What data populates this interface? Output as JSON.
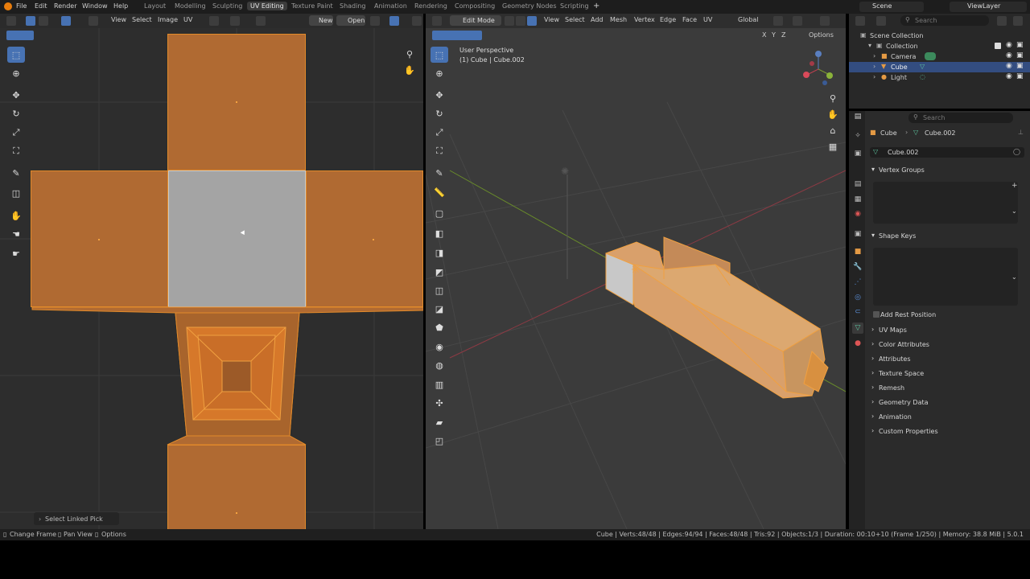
{
  "topbar": {
    "menus": [
      "File",
      "Edit",
      "Render",
      "Window",
      "Help"
    ],
    "workspaces": [
      "Layout",
      "Modelling",
      "Sculpting",
      "UV Editing",
      "Texture Paint",
      "Shading",
      "Animation",
      "Rendering",
      "Compositing",
      "Geometry Nodes",
      "Scripting"
    ],
    "active_workspace": "UV Editing",
    "scene": "Scene",
    "view_layer": "ViewLayer"
  },
  "uv_editor": {
    "menus": [
      "View",
      "Select",
      "Image",
      "UV"
    ],
    "new_label": "New",
    "open_label": "Open",
    "operator_panel": "Select Linked Pick"
  },
  "viewport": {
    "mode": "Edit Mode",
    "menus": [
      "View",
      "Select",
      "Add",
      "Mesh",
      "Vertex",
      "Edge",
      "Face",
      "UV"
    ],
    "transform_orientation": "Global",
    "axes": [
      "X",
      "Y",
      "Z"
    ],
    "options_label": "Options",
    "info_line1": "User Perspective",
    "info_line2": "(1) Cube | Cube.002"
  },
  "outliner": {
    "search_placeholder": "Search",
    "rows": [
      {
        "label": "Scene Collection",
        "icon": "collection-icon"
      },
      {
        "label": "Collection",
        "icon": "collection-icon"
      },
      {
        "label": "Camera",
        "icon": "camera-icon"
      },
      {
        "label": "Cube",
        "icon": "mesh-icon"
      },
      {
        "label": "Light",
        "icon": "light-icon"
      }
    ]
  },
  "properties": {
    "search_placeholder": "Search",
    "breadcrumb_object": "Cube",
    "breadcrumb_data": "Cube.002",
    "data_name": "Cube.002",
    "panels": [
      "Vertex Groups",
      "Shape Keys",
      "UV Maps",
      "Color Attributes",
      "Attributes",
      "Texture Space",
      "Remesh",
      "Geometry Data",
      "Animation",
      "Custom Properties"
    ],
    "add_rest_position": "Add Rest Position"
  },
  "statusbar": {
    "left": [
      "Change Frame",
      "Pan View",
      "Options"
    ],
    "stats": "Cube | Verts:48/48 | Edges:94/94 | Faces:48/48 | Tris:92 | Objects:1/3 | Duration: 00:10+10 (Frame 1/250) | Memory: 38.8 MiB | 5.0.1"
  },
  "colors": {
    "accent": "#4772b3",
    "uv_face": "#b06a32",
    "uv_edge": "#e28a2a",
    "selected_face": "#a4a4a4"
  }
}
